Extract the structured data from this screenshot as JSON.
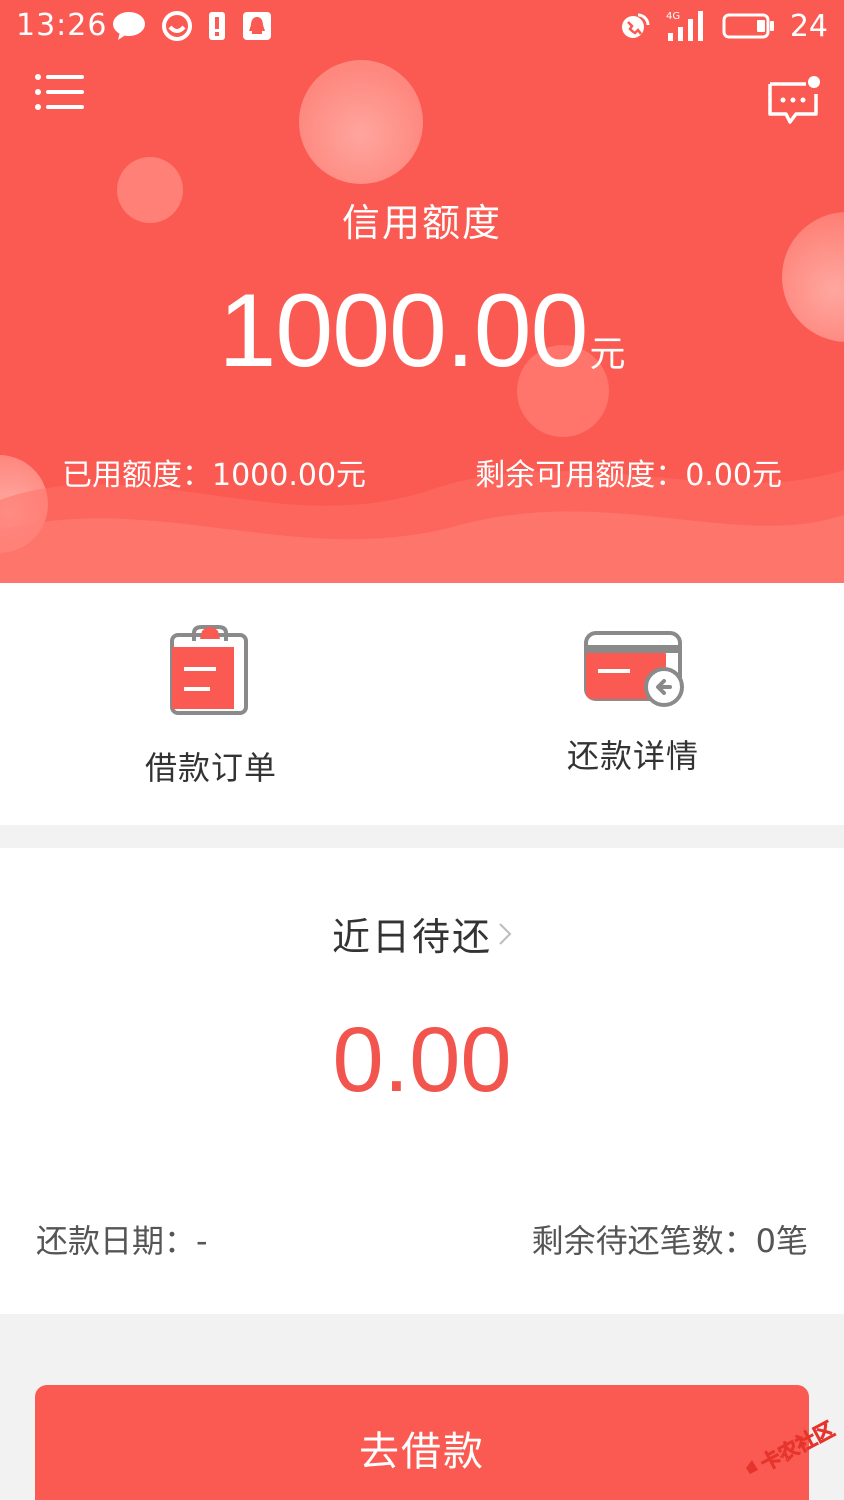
{
  "status_bar": {
    "time": "13:26",
    "network": "4G",
    "battery": "24"
  },
  "hero": {
    "credit_label": "信用额度",
    "credit_amount": "1000.00",
    "credit_unit": "元",
    "used_credit": "已用额度：1000.00元",
    "remaining_credit": "剩余可用额度：0.00元"
  },
  "actions": [
    {
      "label": "借款订单",
      "icon": "clipboard-icon"
    },
    {
      "label": "还款详情",
      "icon": "card-refund-icon"
    }
  ],
  "pending": {
    "title": "近日待还",
    "amount": "0.00",
    "due_date": "还款日期：-",
    "remaining_count": "剩余待还笔数：0笔"
  },
  "borrow_button": {
    "label": "去借款"
  },
  "watermark": {
    "text": "卡农社区"
  },
  "colors": {
    "brand_red": "#fa5a51",
    "amount_red": "#f1554d",
    "icon_gray": "#8a8a8a",
    "background": "#f2f2f2"
  }
}
